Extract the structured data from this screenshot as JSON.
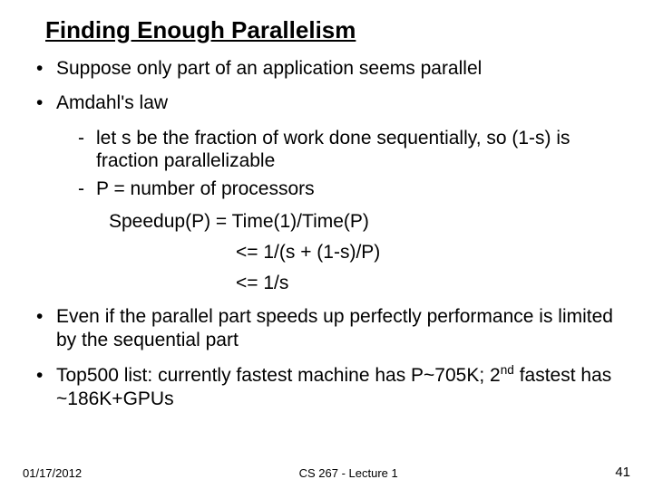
{
  "title": "Finding Enough Parallelism",
  "bullets": {
    "b1": "Suppose only part of an application seems parallel",
    "b2": "Amdahl's law",
    "b2a": "let s be the fraction of work done sequentially, so (1-s) is fraction parallelizable",
    "b2b": "P = number of processors",
    "eq1": "Speedup(P) = Time(1)/Time(P)",
    "eq2": "<= 1/(s + (1-s)/P)",
    "eq3": "<= 1/s",
    "b3": "Even if the parallel part speeds up perfectly performance is limited by the sequential part",
    "b4_pre": "Top500 list: currently fastest machine has P~705K; 2",
    "b4_sup": "nd",
    "b4_post": " fastest has ~186K+GPUs"
  },
  "footer": {
    "date": "01/17/2012",
    "course": "CS 267 - Lecture 1",
    "page": "41"
  }
}
